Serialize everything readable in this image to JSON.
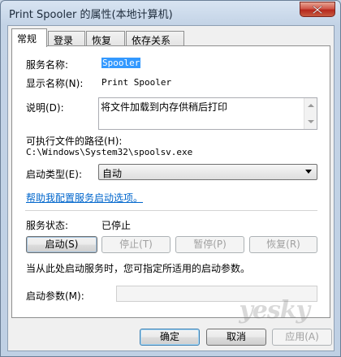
{
  "window": {
    "title": "Print Spooler 的属性(本地计算机)"
  },
  "tabs": [
    {
      "label": "常规",
      "active": true
    },
    {
      "label": "登录"
    },
    {
      "label": "恢复"
    },
    {
      "label": "依存关系"
    }
  ],
  "general": {
    "service_name_label": "服务名称:",
    "service_name_value": "Spooler",
    "display_name_label": "显示名称(N):",
    "display_name_value": "Print Spooler",
    "description_label": "说明(D):",
    "description_value": "将文件加载到内存供稍后打印",
    "exe_path_label": "可执行文件的路径(H):",
    "exe_path_value": "C:\\Windows\\System32\\spoolsv.exe",
    "startup_type_label": "启动类型(E):",
    "startup_type_value": "自动",
    "help_link": "帮助我配置服务启动选项。",
    "status_label": "服务状态:",
    "status_value": "已停止",
    "buttons": {
      "start": "启动(S)",
      "stop": "停止(T)",
      "pause": "暂停(P)",
      "resume": "恢复(R)"
    },
    "hint": "当从此处启动服务时，您可指定所适用的启动参数。",
    "start_params_label": "启动参数(M):",
    "start_params_value": ""
  },
  "footer": {
    "ok": "确定",
    "cancel": "取消",
    "apply": "应用(A)"
  },
  "watermark": "yesky"
}
